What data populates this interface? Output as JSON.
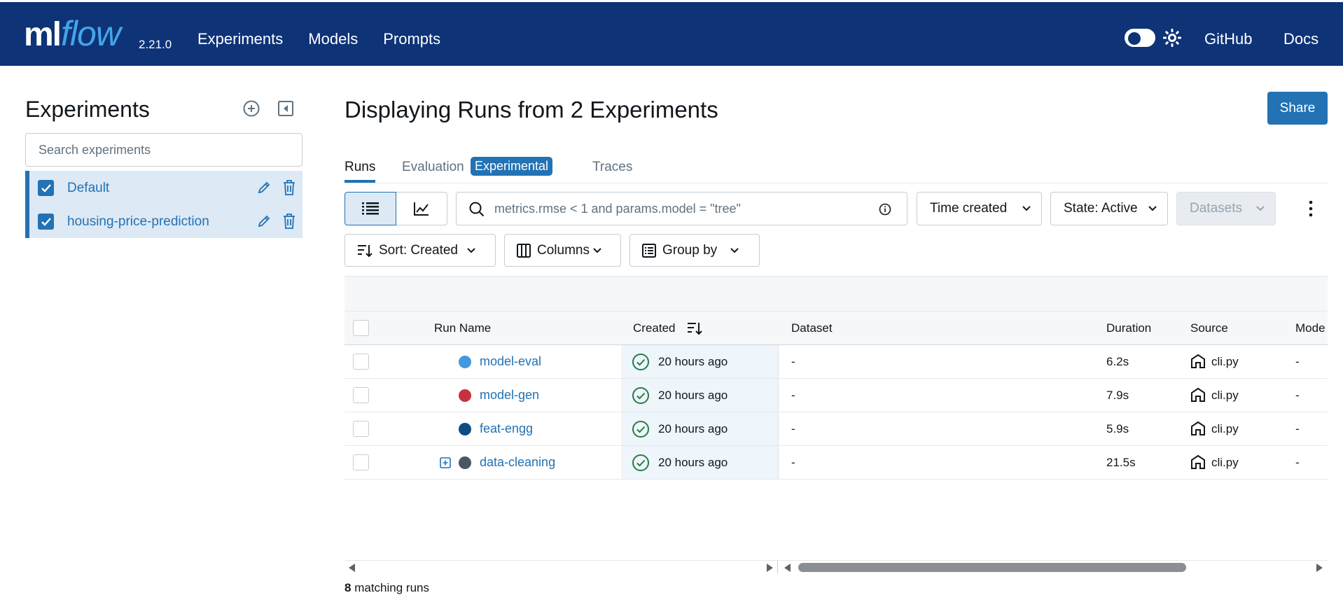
{
  "header": {
    "logo_ml": "ml",
    "logo_flow": "flow",
    "version": "2.21.0",
    "nav": [
      "Experiments",
      "Models",
      "Prompts"
    ],
    "github": "GitHub",
    "docs": "Docs",
    "theme_icon": "sun-icon"
  },
  "sidebar": {
    "title": "Experiments",
    "search_placeholder": "Search experiments",
    "experiments": [
      {
        "name": "Default",
        "checked": true
      },
      {
        "name": "housing-price-prediction",
        "checked": true
      }
    ]
  },
  "main": {
    "title": "Displaying Runs from 2 Experiments",
    "share": "Share",
    "tabs": {
      "runs": "Runs",
      "evaluation": "Evaluation",
      "experimental_badge": "Experimental",
      "traces": "Traces"
    },
    "filter_value": "metrics.rmse < 1 and params.model = \"tree\"",
    "time_dropdown": "Time created",
    "state_dropdown": "State: Active",
    "datasets_dropdown": "Datasets",
    "sort": "Sort: Created",
    "columns": "Columns",
    "group_by": "Group by"
  },
  "table": {
    "headers": {
      "run_name": "Run Name",
      "created": "Created",
      "dataset": "Dataset",
      "duration": "Duration",
      "source": "Source",
      "models": "Mode"
    },
    "rows": [
      {
        "name": "model-eval",
        "color": "#4299e0",
        "created": "20 hours ago",
        "dataset": "-",
        "duration": "6.2s",
        "source": "cli.py",
        "models": "-",
        "expandable": false
      },
      {
        "name": "model-gen",
        "color": "#c8323f",
        "created": "20 hours ago",
        "dataset": "-",
        "duration": "7.9s",
        "source": "cli.py",
        "models": "-",
        "expandable": false
      },
      {
        "name": "feat-engg",
        "color": "#0e4c84",
        "created": "20 hours ago",
        "dataset": "-",
        "duration": "5.9s",
        "source": "cli.py",
        "models": "-",
        "expandable": false
      },
      {
        "name": "data-cleaning",
        "color": "#4b5563",
        "created": "20 hours ago",
        "dataset": "-",
        "duration": "21.5s",
        "source": "cli.py",
        "models": "-",
        "expandable": true
      }
    ]
  },
  "footer": {
    "count": "8",
    "label": "matching runs"
  }
}
